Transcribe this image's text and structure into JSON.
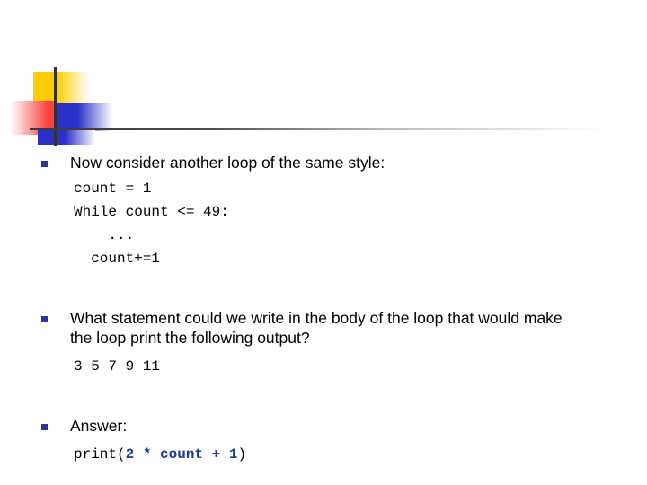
{
  "slide": {
    "decoration": {
      "yellow_color": "#FFCC00",
      "red_color": "#F8443C",
      "blue_color": "#2B31C6",
      "line_color": "#333333"
    },
    "bullet_color": "#33339C",
    "blocks": [
      {
        "bullet": "Now consider another loop of the same style:",
        "code_lines": [
          "count = 1",
          "While count <= 49:",
          "    ...",
          "  count+=1"
        ]
      },
      {
        "bullet": "What statement could we write in the body of the loop that would make the loop print the following output?",
        "code_lines": [
          "3 5 7 9 11"
        ]
      },
      {
        "bullet": "Answer:",
        "answer_code": {
          "prefix": "print(",
          "expression": "2 * count + 1",
          "suffix": ")"
        }
      }
    ]
  }
}
